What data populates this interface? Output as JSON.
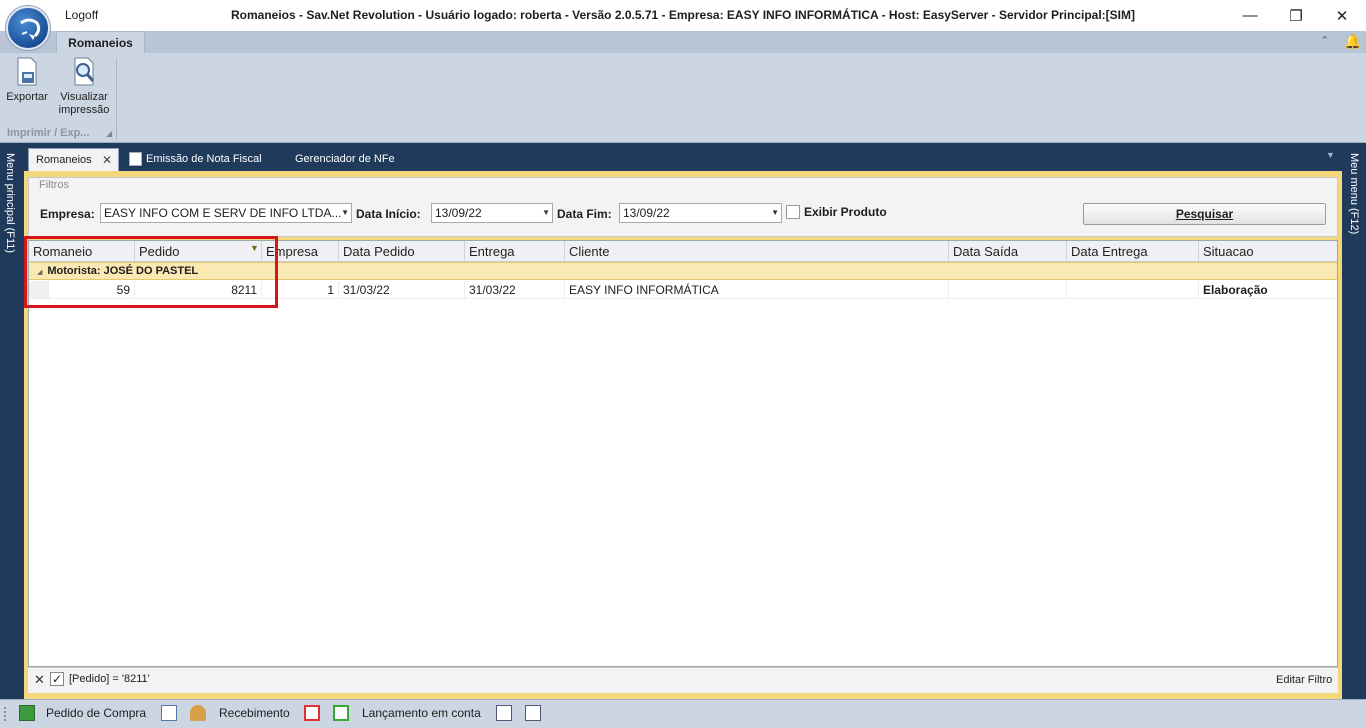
{
  "titlebar": {
    "logoff_label": "Logoff",
    "title": "Romaneios - Sav.Net Revolution - Usuário logado: roberta - Versão 2.0.5.71 - Empresa: EASY INFO INFORMÁTICA - Host: EasyServer - Servidor Principal:[SIM]"
  },
  "ribbon": {
    "tab_label": "Romaneios",
    "export_label": "Exportar",
    "preview_label_line1": "Visualizar",
    "preview_label_line2": "impressão",
    "group_label": "Imprimir / Exp..."
  },
  "sidebars": {
    "left_label": "Menu principal (F11)",
    "right_label": "Meu menu (F12)"
  },
  "doc_tabs": [
    {
      "label": "Romaneios"
    },
    {
      "label": "Emissão de Nota Fiscal"
    },
    {
      "label": "Gerenciador de NFe"
    }
  ],
  "filters": {
    "legend": "Filtros",
    "empresa_label": "Empresa:",
    "empresa_value": "EASY INFO COM E SERV DE INFO LTDA...",
    "data_inicio_label": "Data Início:",
    "data_inicio_value": "13/09/22",
    "data_fim_label": "Data Fim:",
    "data_fim_value": "13/09/22",
    "exibir_produto_label": "Exibir Produto",
    "exibir_produto_checked": false,
    "search_button_label": "Pesquisar"
  },
  "grid": {
    "columns": [
      "Romaneio",
      "Pedido",
      "Empresa",
      "Data Pedido",
      "Entrega",
      "Cliente",
      "Data Saída",
      "Data Entrega",
      "Situacao"
    ],
    "group_label": "Motorista: JOSÉ DO PASTEL",
    "rows": [
      {
        "romaneio": "59",
        "pedido": "8211",
        "empresa": "1",
        "data_pedido": "31/03/22",
        "entrega": "31/03/22",
        "cliente": "EASY INFO INFORMÁTICA",
        "data_saida": "",
        "data_entrega": "",
        "situacao": "Elaboração"
      }
    ]
  },
  "filter_bar": {
    "expression": "[Pedido] = '8211'",
    "enabled": true,
    "edit_label": "Editar Filtro"
  },
  "statusbar": {
    "pedido_compra_label": "Pedido de Compra",
    "recebimento_label": "Recebimento",
    "lancamento_label": "Lançamento em conta"
  },
  "colors": {
    "frame": "#1f3a5a",
    "ribbon": "#ccd5e2",
    "group_row": "#fbe9b3",
    "highlight": "#d6141c",
    "content_border": "#f4d77a"
  }
}
